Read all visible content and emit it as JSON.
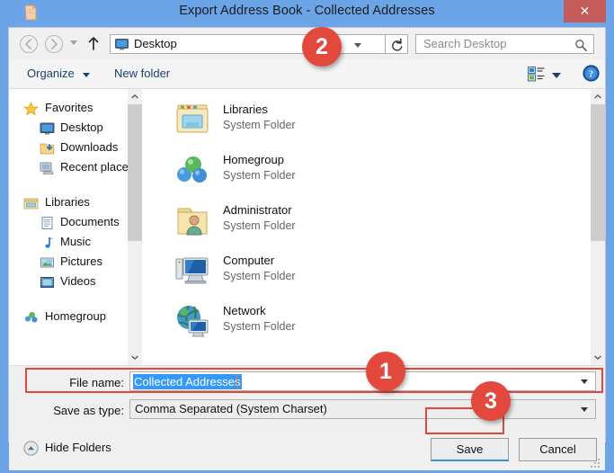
{
  "window": {
    "title": "Export Address Book - Collected Addresses",
    "icon": "folder-icon",
    "close_label": "✕"
  },
  "navbar": {
    "back_icon": "back-arrow-icon",
    "forward_icon": "forward-arrow-icon",
    "recent_icon": "recent-locations-caret-icon",
    "up_icon": "up-arrow-icon",
    "address_value": "Desktop",
    "address_icon": "desktop-icon",
    "refresh_icon": "refresh-icon",
    "search_placeholder": "Search Desktop",
    "search_icon": "search-icon"
  },
  "toolbar": {
    "organize_label": "Organize",
    "new_folder_label": "New folder",
    "view_icon": "view-layout-icon",
    "help_icon": "help-icon"
  },
  "sidebar": {
    "groups": [
      {
        "label": "Favorites",
        "icon": "star-icon",
        "items": [
          {
            "label": "Desktop",
            "icon": "desktop-icon"
          },
          {
            "label": "Downloads",
            "icon": "downloads-folder-icon"
          },
          {
            "label": "Recent places",
            "icon": "recent-places-icon"
          }
        ]
      },
      {
        "label": "Libraries",
        "icon": "libraries-icon",
        "items": [
          {
            "label": "Documents",
            "icon": "documents-icon"
          },
          {
            "label": "Music",
            "icon": "music-icon"
          },
          {
            "label": "Pictures",
            "icon": "pictures-icon"
          },
          {
            "label": "Videos",
            "icon": "videos-icon"
          }
        ]
      },
      {
        "label": "Homegroup",
        "icon": "homegroup-icon",
        "items": []
      }
    ]
  },
  "file_list": [
    {
      "name": "Libraries",
      "type": "System Folder",
      "icon": "libraries-folder-icon"
    },
    {
      "name": "Homegroup",
      "type": "System Folder",
      "icon": "homegroup-icon"
    },
    {
      "name": "Administrator",
      "type": "System Folder",
      "icon": "user-folder-icon"
    },
    {
      "name": "Computer",
      "type": "System Folder",
      "icon": "computer-icon"
    },
    {
      "name": "Network",
      "type": "System Folder",
      "icon": "network-icon"
    }
  ],
  "form": {
    "filename_label": "File name:",
    "filename_value": "Collected Addresses",
    "savetype_label": "Save as type:",
    "savetype_value": "Comma Separated (System Charset)"
  },
  "footer": {
    "hide_folders_label": "Hide Folders",
    "hide_folders_icon": "collapse-chevron-icon",
    "save_label": "Save",
    "cancel_label": "Cancel",
    "resize_grip_icon": "resize-grip-icon"
  },
  "annotations": {
    "badge_1": "1",
    "badge_2": "2",
    "badge_3": "3",
    "highlight_color": "#e2483c"
  },
  "colors": {
    "titlebar": "#6ba5e7",
    "close_button": "#c35b5b",
    "selection": "#3399ff",
    "accent_button_underline": "#3b8fd4"
  }
}
